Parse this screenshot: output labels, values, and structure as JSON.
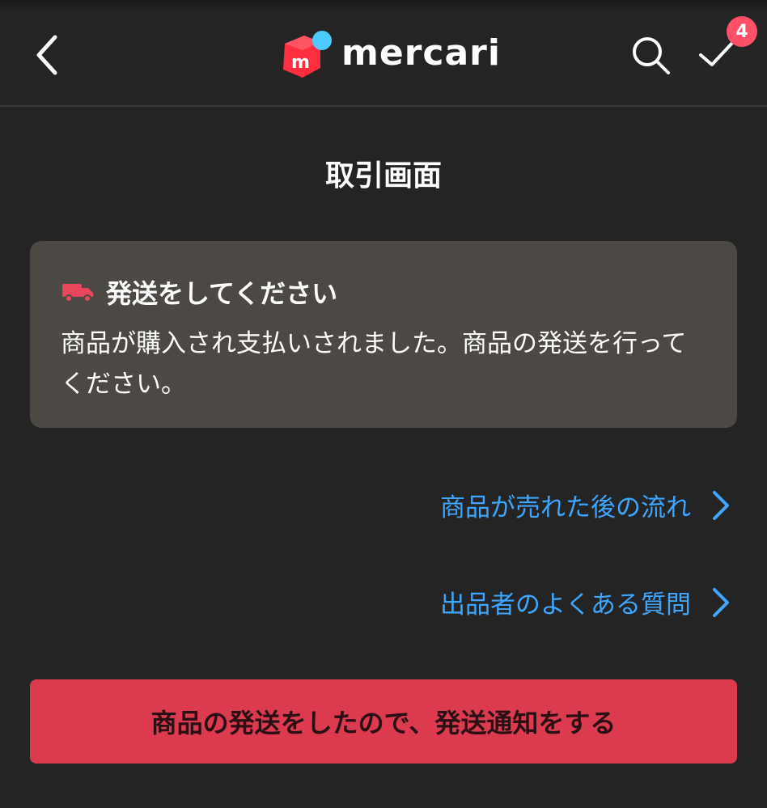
{
  "header": {
    "logo_text": "mercari",
    "badge_count": "4",
    "icons": {
      "back": "chevron-left-icon",
      "search": "search-icon",
      "todo": "checkmark-icon"
    },
    "colors": {
      "logo_red": "#ff2d40",
      "logo_blue": "#4dc9ff",
      "badge": "#ff5068"
    }
  },
  "page": {
    "title": "取引画面"
  },
  "notice": {
    "icon": "truck-icon",
    "title": "発送をしてください",
    "body": "商品が購入され支払いされました。商品の発送を行ってください。",
    "colors": {
      "background": "#4c4944",
      "truck": "#e8475b"
    }
  },
  "links": [
    {
      "label": "商品が売れた後の流れ"
    },
    {
      "label": "出品者のよくある質問"
    }
  ],
  "link_color": "#3ea6ff",
  "cta": {
    "label": "商品の発送をしたので、発送通知をする",
    "color": "#dc3b4f"
  }
}
